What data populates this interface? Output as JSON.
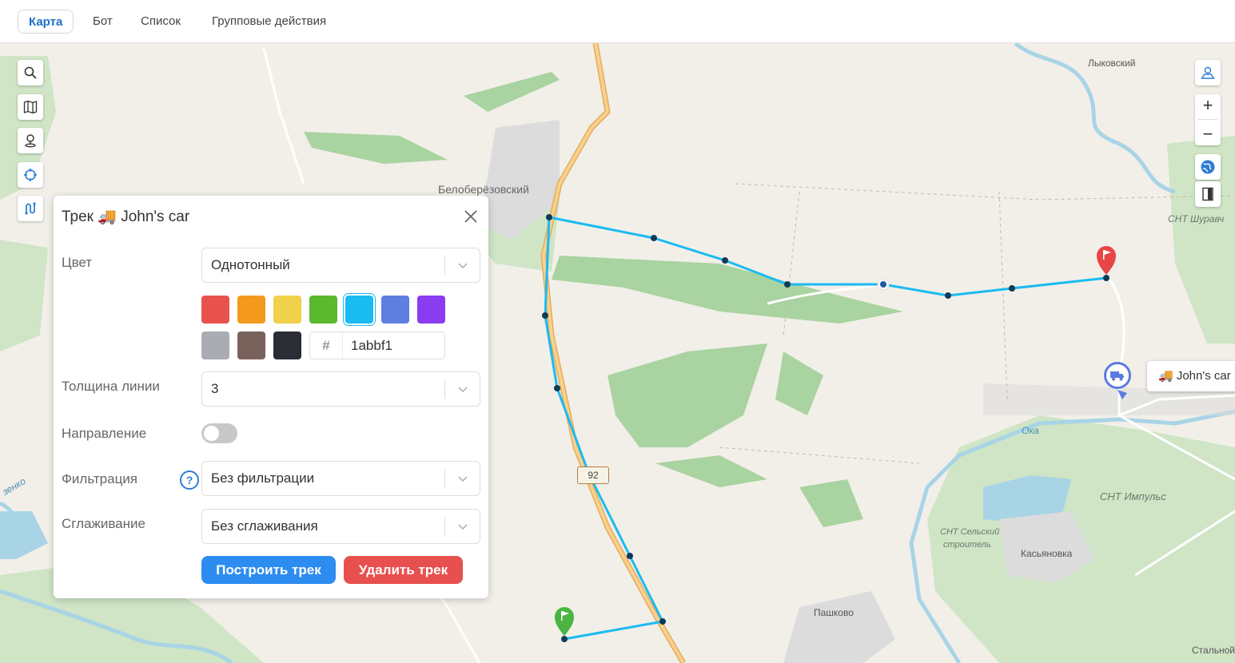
{
  "tabs": [
    {
      "label": "Карта",
      "active": true
    },
    {
      "label": "Бот",
      "active": false
    },
    {
      "label": "Список",
      "active": false
    },
    {
      "label": "Групповые действия",
      "active": false
    }
  ],
  "map": {
    "labels": {
      "belobereozovsky": "Белоберёзовский",
      "lykovsky": "Лыковский",
      "snt_shuravi": "СНТ Шуравч",
      "oka": "Ока",
      "snt_impuls": "СНТ Импульс",
      "snt_selsky_1": "СНТ Сельский",
      "snt_selsky_2": "строитель",
      "kasyanovka": "Касьяновка",
      "pashkovo": "Пашково",
      "stalnoy": "Стальной",
      "river_left": "зенко"
    },
    "road_number": "92",
    "track_color": "#1abbf1",
    "controls_left": [
      "search-icon",
      "map-icon",
      "pin-icon",
      "crosshair-icon",
      "track-icon"
    ],
    "controls_right": [
      "landscape-icon",
      "zoom-in-icon",
      "zoom-out-icon",
      "globe-icon",
      "door-icon"
    ],
    "zoom_in": "+",
    "zoom_out": "−",
    "car_tooltip": "🚚 John's car"
  },
  "panel": {
    "title": "Трек 🚚 John's car",
    "color_label": "Цвет",
    "color_mode": "Однотонный",
    "swatches": [
      "#e9534f",
      "#f39a1e",
      "#f1d04a",
      "#5ab92f",
      "#1abbf1",
      "#5e7ee0",
      "#8a3cf0",
      "#a9acb3",
      "#7a625c",
      "#2a2d36"
    ],
    "selected_swatch": 4,
    "hex_prefix": "#",
    "hex_value": "1abbf1",
    "thickness_label": "Толщина линии",
    "thickness_value": "3",
    "direction_label": "Направление",
    "direction_on": false,
    "filter_label": "Фильтрация",
    "help_symbol": "?",
    "filter_value": "Без фильтрации",
    "smooth_label": "Сглаживание",
    "smooth_value": "Без сглаживания",
    "build_button": "Построить трек",
    "delete_button": "Удалить трек"
  }
}
